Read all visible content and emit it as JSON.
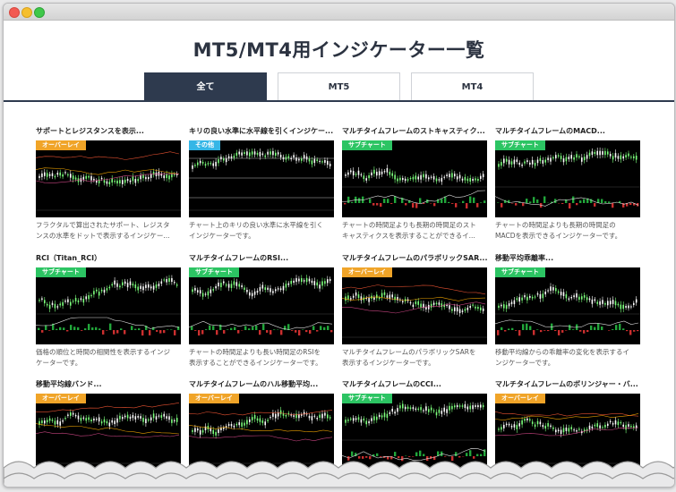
{
  "page": {
    "title": "MT5/MT4用インジケーター一覧"
  },
  "tabs": [
    {
      "label": "全て",
      "active": true
    },
    {
      "label": "MT5",
      "active": false
    },
    {
      "label": "MT4",
      "active": false
    }
  ],
  "colors": {
    "overlay": "#f0a428",
    "subchart": "#2cc463",
    "other": "#35b6e6",
    "tab_active": "#2e3a4e"
  },
  "cards": [
    {
      "title": "サポートとレジスタンスを表示...",
      "badge": "オーバーレイ",
      "badge_type": "overlay",
      "desc_lines": [
        "フラクタルで算出されたサポート、レジスタ",
        "ンスの水準をドットで表示するインジケー..."
      ]
    },
    {
      "title": "キリの良い水準に水平線を引くインジケー...",
      "badge": "その他",
      "badge_type": "other",
      "desc_lines": [
        "チャート上のキリの良い水準に水平線を引く",
        "インジケーターです。"
      ]
    },
    {
      "title": "マルチタイムフレームのストキャスティク...",
      "badge": "サブチャート",
      "badge_type": "subchart",
      "desc_lines": [
        "チャートの時間足よりも長期の時間足のスト",
        "キャスティクスを表示することができるイ..."
      ]
    },
    {
      "title": "マルチタイムフレームのMACD...",
      "badge": "サブチャート",
      "badge_type": "subchart",
      "desc_lines": [
        "チャートの時間足よりも長期の時間足の",
        "MACDを表示できるインジケーターです。"
      ]
    },
    {
      "title": "RCI（Titan_RCI）",
      "badge": "サブチャート",
      "badge_type": "subchart",
      "desc_lines": [
        "価格の順位と時間の相関性を表示するインジ",
        "ケーターです。"
      ]
    },
    {
      "title": "マルチタイムフレームのRSI...",
      "badge": "サブチャート",
      "badge_type": "subchart",
      "desc_lines": [
        "チャートの時間足よりも長い時間足のRSIを",
        "表示することができるインジケーターです。"
      ]
    },
    {
      "title": "マルチタイムフレームのパラボリックSAR...",
      "badge": "オーバーレイ",
      "badge_type": "overlay",
      "desc_lines": [
        "マルチタイムフレームのパラボリックSARを",
        "表示するインジケーターです。"
      ]
    },
    {
      "title": "移動平均乖離率...",
      "badge": "サブチャート",
      "badge_type": "subchart",
      "desc_lines": [
        "移動平均線からの乖離率の変化を表示するイ",
        "ンジケーターです。"
      ]
    },
    {
      "title": "移動平均線バンド...",
      "badge": "オーバーレイ",
      "badge_type": "overlay",
      "desc_lines": [
        "",
        ""
      ]
    },
    {
      "title": "マルチタイムフレームのハル移動平均...",
      "badge": "オーバーレイ",
      "badge_type": "overlay",
      "desc_lines": [
        "",
        ""
      ]
    },
    {
      "title": "マルチタイムフレームのCCI...",
      "badge": "サブチャート",
      "badge_type": "subchart",
      "desc_lines": [
        "",
        ""
      ]
    },
    {
      "title": "マルチタイムフレームのボリンジャー・バ...",
      "badge": "オーバーレイ",
      "badge_type": "overlay",
      "desc_lines": [
        "",
        ""
      ]
    }
  ]
}
